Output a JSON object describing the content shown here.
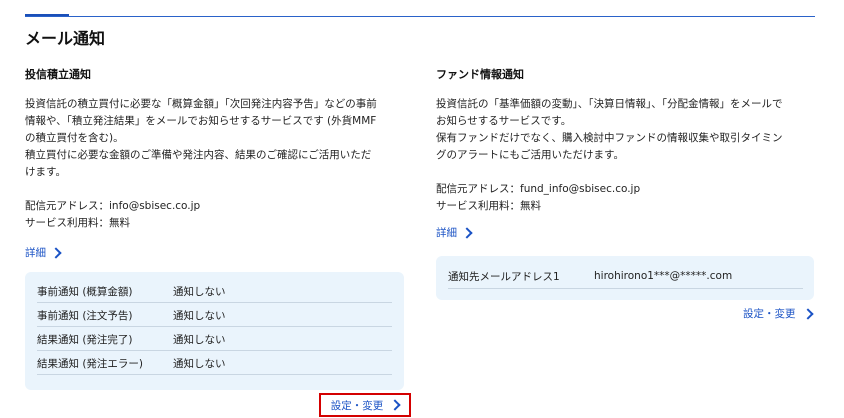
{
  "page_title": "メール通知",
  "left": {
    "title": "投信積立通知",
    "desc": [
      "投資信託の積立買付に必要な「概算金額」「次回発注内容予告」などの事前",
      "情報や、「積立発注結果」をメールでお知らせするサービスです (外貨MMF",
      "の積立買付を含む)。",
      "積立買付に必要な金額のご準備や発注内容、結果のご確認にご活用いただ",
      "けます。"
    ],
    "sender": "配信元アドレス：info@sbisec.co.jp",
    "fee": "サービス利用料：無料",
    "detail_label": "詳細",
    "settings": [
      {
        "label": "事前通知 (概算金額)",
        "value": "通知しない"
      },
      {
        "label": "事前通知 (注文予告)",
        "value": "通知しない"
      },
      {
        "label": "結果通知 (発注完了)",
        "value": "通知しない"
      },
      {
        "label": "結果通知 (発注エラー)",
        "value": "通知しない"
      }
    ],
    "change_label": "設定・変更"
  },
  "right": {
    "title": "ファンド情報通知",
    "desc": [
      "投資信託の「基準価額の変動」、「決算日情報」、「分配金情報」をメールで",
      "お知らせするサービスです。",
      "保有ファンドだけでなく、購入検討中ファンドの情報収集や取引タイミン",
      "グのアラートにもご活用いただけます。"
    ],
    "sender": "配信元アドレス：fund_info@sbisec.co.jp",
    "fee": "サービス利用料：無料",
    "detail_label": "詳細",
    "email_label": "通知先メールアドレス1",
    "email_value": "hirohirono1***@*****.com",
    "change_label": "設定・変更"
  },
  "colors": {
    "accent": "#1b53c5",
    "panel": "#eaf4fc",
    "highlight": "#d40000"
  }
}
